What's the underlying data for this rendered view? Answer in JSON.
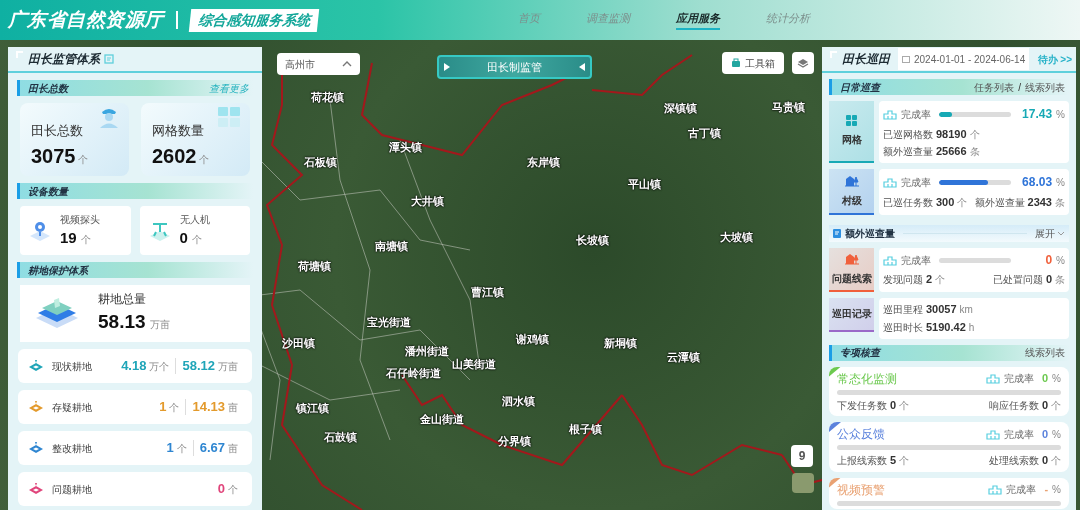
{
  "header": {
    "title": "广东省自然资源厅",
    "subtitle": "综合感知服务系统",
    "nav": [
      {
        "label": "首页",
        "selected": false
      },
      {
        "label": "调查监测",
        "selected": false
      },
      {
        "label": "应用服务",
        "selected": true
      },
      {
        "label": "统计分析",
        "selected": false
      }
    ]
  },
  "left_panel": {
    "title": "田长监管体系",
    "chief_section": {
      "title": "田长总数",
      "link": "查看更多",
      "stats": [
        {
          "kind": "person",
          "label": "田长总数",
          "value": "3075",
          "unit": "个"
        },
        {
          "kind": "grid",
          "label": "网格数量",
          "value": "2602",
          "unit": "个"
        }
      ]
    },
    "device_section": {
      "title": "设备数量",
      "devices": [
        {
          "kind": "camera",
          "label": "视频探头",
          "value": "19",
          "unit": "个"
        },
        {
          "kind": "drone",
          "label": "无人机",
          "value": "0",
          "unit": "个"
        }
      ]
    },
    "farmland_section": {
      "title": "耕地保护体系",
      "total": {
        "label": "耕地总量",
        "value": "58.13",
        "unit": "万亩"
      },
      "rows": [
        {
          "label": "现状耕地",
          "count": "4.18",
          "count_unit": "万个",
          "area": "58.12",
          "area_unit": "万亩",
          "color": "#1fa5b8"
        },
        {
          "label": "存疑耕地",
          "count": "1",
          "count_unit": "个",
          "area": "14.13",
          "area_unit": "亩",
          "color": "#e39a2c"
        },
        {
          "label": "整改耕地",
          "count": "1",
          "count_unit": "个",
          "area": "6.67",
          "area_unit": "亩",
          "color": "#2f86d1"
        },
        {
          "label": "问题耕地",
          "count": "0",
          "count_unit": "个",
          "color": "#e0457b"
        }
      ]
    }
  },
  "map": {
    "region_select": "高州市",
    "banner": "田长制监管",
    "toolbox": "工具箱",
    "zoom_level": "9",
    "labels": [
      "荷花镇",
      "潭头镇",
      "石板镇",
      "东岸镇",
      "大井镇",
      "南塘镇",
      "荷塘镇",
      "曹江镇",
      "宝光街道",
      "沙田镇",
      "潘州街道",
      "山美街道",
      "石仔岭街道",
      "镇江镇",
      "石鼓镇",
      "金山街道",
      "泗水镇",
      "分界镇",
      "根子镇",
      "谢鸡镇",
      "新垌镇",
      "云潭镇",
      "长坡镇",
      "大坡镇",
      "平山镇",
      "古丁镇",
      "深镇镇",
      "马贵镇"
    ]
  },
  "right_panel": {
    "title": "田长巡田",
    "date_range": "2024-01-01 - 2024-06-14",
    "todo": "待办 >>",
    "daily": {
      "title": "日常巡查",
      "links": [
        "任务列表",
        "线索列表"
      ],
      "separator": "/",
      "cards": [
        {
          "label": "网格",
          "kind": "grid",
          "color": "#17a9b5",
          "rate_label": "完成率",
          "level": 0.1743,
          "reading": "17.43",
          "reading_unit": "%",
          "stats": [
            {
              "label": "已巡网格数",
              "value": "98190",
              "unit": "个"
            },
            {
              "label": "额外巡查量",
              "value": "25666",
              "unit": "条"
            }
          ]
        },
        {
          "label": "村级",
          "kind": "village",
          "color": "#2f74d8",
          "rate_label": "完成率",
          "level": 0.6803,
          "reading": "68.03",
          "reading_unit": "%",
          "stats": [
            {
              "label": "已巡任务数",
              "value": "300",
              "unit": "个"
            },
            {
              "label": "额外巡查量",
              "value": "2343",
              "unit": "条"
            }
          ]
        }
      ]
    },
    "extra": {
      "title": "额外巡查量",
      "toggle": "展开",
      "cards": [
        {
          "label": "问题线索",
          "kind": "rate",
          "color": "#f0603c",
          "rate_label": "完成率",
          "level": 0,
          "reading": "0",
          "reading_unit": "%",
          "stats": [
            {
              "label": "发现问题",
              "value": "2",
              "unit": "个"
            },
            {
              "label": "已处置问题",
              "value": "0",
              "unit": "条"
            }
          ]
        },
        {
          "label": "巡田记录",
          "kind": "record",
          "color": "#9a6ac8",
          "stats": [
            {
              "label": "巡田里程",
              "value": "30057",
              "unit": "km"
            },
            {
              "label": "巡田时长",
              "value": "5190.42",
              "unit": "h"
            }
          ]
        }
      ]
    },
    "special": {
      "title": "专项核查",
      "link": "线索列表",
      "items": [
        {
          "title": "常态化监测",
          "color": "#6cc94f",
          "rate_label": "完成率",
          "reading": "0",
          "reading_unit": "%",
          "level": 0,
          "stats": [
            {
              "label": "下发任务数",
              "value": "0",
              "unit": "个"
            },
            {
              "label": "响应任务数",
              "value": "0",
              "unit": "个"
            }
          ]
        },
        {
          "title": "公众反馈",
          "color": "#5b82dc",
          "rate_label": "完成率",
          "reading": "0",
          "reading_unit": "%",
          "level": 0,
          "stats": [
            {
              "label": "上报线索数",
              "value": "5",
              "unit": "个"
            },
            {
              "label": "处理线索数",
              "value": "0",
              "unit": "个"
            }
          ]
        },
        {
          "title": "视频预警",
          "color": "#e9a273",
          "rate_label": "完成率",
          "reading": "-",
          "reading_unit": "%",
          "level": 0
        }
      ]
    }
  }
}
